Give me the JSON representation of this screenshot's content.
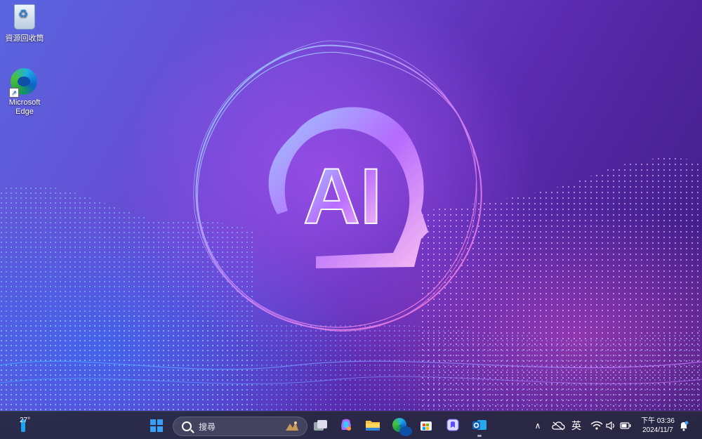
{
  "desktop": {
    "icons": [
      {
        "label": "資源回收筒",
        "icon": "recycle-bin-icon"
      },
      {
        "label": "Microsoft Edge",
        "icon": "edge-icon"
      }
    ],
    "wallpaper_text": "AI"
  },
  "taskbar": {
    "weather": {
      "temp": "27°"
    },
    "search": {
      "placeholder": "搜尋"
    },
    "apps": [
      {
        "name": "start-button",
        "icon": "windows-icon"
      },
      {
        "name": "task-view",
        "icon": "task-view-icon"
      },
      {
        "name": "copilot",
        "icon": "copilot-icon"
      },
      {
        "name": "file-explorer",
        "icon": "folder-icon"
      },
      {
        "name": "edge",
        "icon": "edge-icon"
      },
      {
        "name": "microsoft-store",
        "icon": "store-icon"
      },
      {
        "name": "app",
        "icon": "app-icon"
      },
      {
        "name": "outlook",
        "icon": "outlook-icon"
      }
    ],
    "tray": {
      "ime": "英",
      "time": "下午 03:36",
      "date": "2024/11/7"
    }
  },
  "colors": {
    "accent": "#3aa0f5",
    "taskbar_bg": "#26283e"
  }
}
